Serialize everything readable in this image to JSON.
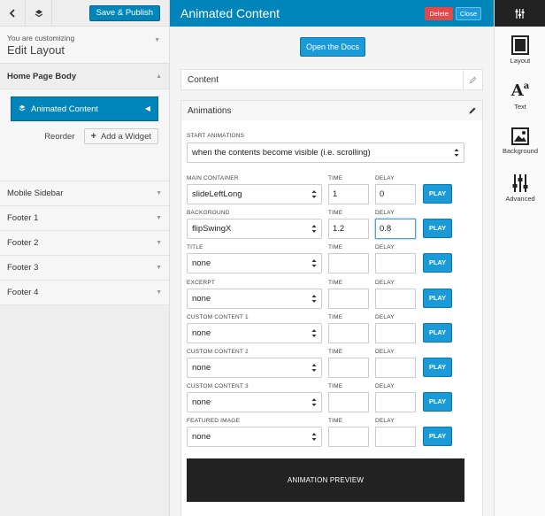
{
  "left": {
    "save_label": "Save & Publish",
    "customizing_small": "You are customizing",
    "customizing_title": "Edit Layout",
    "home_section": "Home Page Body",
    "widget_label": "Animated Content",
    "reorder_label": "Reorder",
    "add_widget_label": "Add a Widget",
    "sections": [
      "Mobile Sidebar",
      "Footer 1",
      "Footer 2",
      "Footer 3",
      "Footer 4"
    ]
  },
  "main": {
    "title": "Animated Content",
    "delete_label": "Delete",
    "close_label": "Close",
    "docs_label": "Open the Docs",
    "content_label": "Content",
    "animations_label": "Animations",
    "start_label": "Start Animations",
    "start_value": "when the contents become visible (i.e. scrolling)",
    "time_label": "Time",
    "delay_label": "Delay",
    "play_label": "PLAY",
    "preview_label": "ANIMATION PREVIEW",
    "rows": [
      {
        "label": "Main Container",
        "value": "slideLeftLong",
        "time": "1",
        "delay": "0"
      },
      {
        "label": "Background",
        "value": "flipSwingX",
        "time": "1.2",
        "delay": "0.8"
      },
      {
        "label": "Title",
        "value": "none",
        "time": "",
        "delay": ""
      },
      {
        "label": "Excerpt",
        "value": "none",
        "time": "",
        "delay": ""
      },
      {
        "label": "Custom Content 1",
        "value": "none",
        "time": "",
        "delay": ""
      },
      {
        "label": "Custom Content 2",
        "value": "none",
        "time": "",
        "delay": ""
      },
      {
        "label": "Custom Content 3",
        "value": "none",
        "time": "",
        "delay": ""
      },
      {
        "label": "Featured Image",
        "value": "none",
        "time": "",
        "delay": ""
      }
    ]
  },
  "toolbar": {
    "items": [
      "Layout",
      "Text",
      "Background",
      "Advanced"
    ],
    "text_icon_glyph": "A",
    "text_icon_sup": "a"
  },
  "colors": {
    "accent": "#0085ba",
    "button": "#1a9bd7",
    "danger": "#e04a4a",
    "preview_bg": "#222222"
  }
}
